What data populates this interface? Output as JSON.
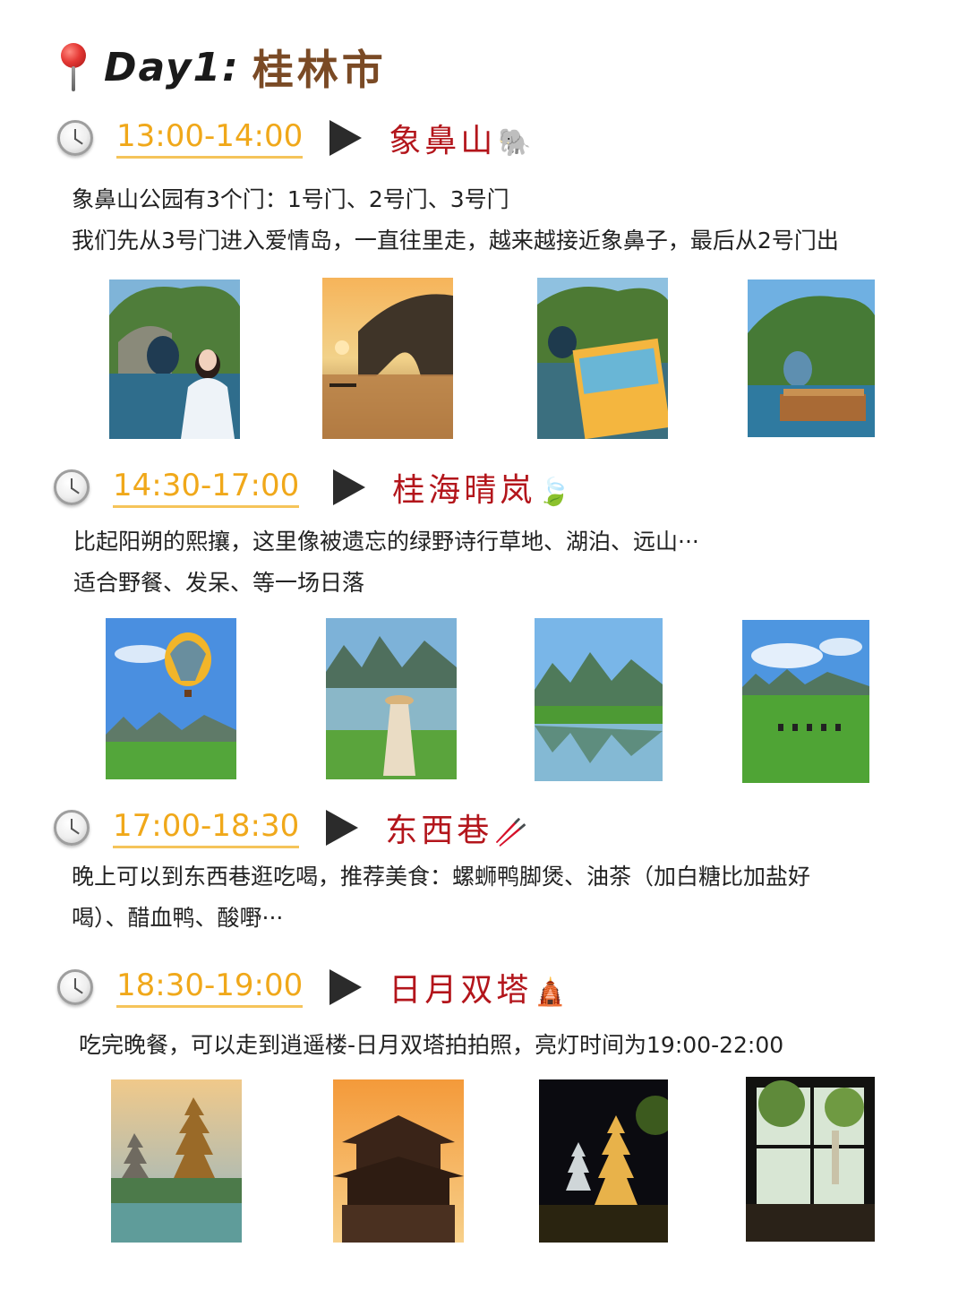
{
  "header": {
    "day": "Day1:",
    "city": "桂林市"
  },
  "sections": [
    {
      "time": "13:00-14:00",
      "place": "象鼻山",
      "emoji": "🐘",
      "lines": [
        "象鼻山公园有3个门：1号门、2号门、3号门",
        "我们先从3号门进入爱情岛，一直往里走，越来越接近象鼻子，最后从2号门出"
      ],
      "photos": [
        "elephant-trunk-hill-woman-photo",
        "elephant-trunk-hill-sunset-photo",
        "elephant-trunk-hill-textbook-photo",
        "elephant-trunk-hill-boat-photo"
      ]
    },
    {
      "time": "14:30-17:00",
      "place": "桂海晴岚",
      "emoji": "🍃",
      "lines": [
        "比起阳朔的熙攘，这里像被遗忘的绿野诗行草地、湖泊、远山···",
        "适合野餐、发呆、等一场日落"
      ],
      "photos": [
        "hot-air-balloon-photo",
        "lake-woman-hat-photo",
        "mountain-reflection-photo",
        "meadow-geese-photo"
      ]
    },
    {
      "time": "17:00-18:30",
      "place": "东西巷",
      "emoji": "🥢",
      "lines": [
        "晚上可以到东西巷逛吃喝，推荐美食：螺蛳鸭脚煲、油茶（加白糖比加盐好",
        "喝）、醋血鸭、酸嘢···"
      ],
      "photos": []
    },
    {
      "time": "18:30-19:00",
      "place": "日月双塔",
      "emoji": "🛕",
      "lines": [
        "吃完晚餐，可以走到逍遥楼-日月双塔拍拍照，亮灯时间为19:00-22:00"
      ],
      "photos": [
        "twin-pagodas-day-photo",
        "xiaoyao-tower-sunset-photo",
        "twin-pagodas-night-photo",
        "window-pagoda-view-photo"
      ]
    }
  ]
}
